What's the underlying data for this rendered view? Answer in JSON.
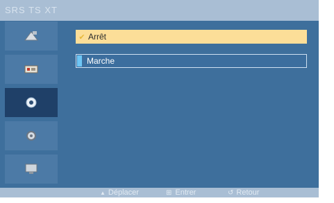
{
  "title": "SRS TS XT",
  "sidebar": {
    "items": [
      {
        "icon": "picture-icon"
      },
      {
        "icon": "sound-icon"
      },
      {
        "icon": "setup-icon"
      },
      {
        "icon": "input-icon"
      },
      {
        "icon": "monitor-icon"
      }
    ],
    "active_index": 2
  },
  "options": [
    {
      "label": "Arrêt",
      "checked": true
    },
    {
      "label": "Marche",
      "checked": false
    }
  ],
  "footer": {
    "move": "Déplacer",
    "enter": "Entrer",
    "return": "Retour"
  },
  "colors": {
    "background": "#3e6f9c",
    "bar": "#a9bed4",
    "selected": "#fcde98",
    "active_tab": "#1f4068"
  }
}
